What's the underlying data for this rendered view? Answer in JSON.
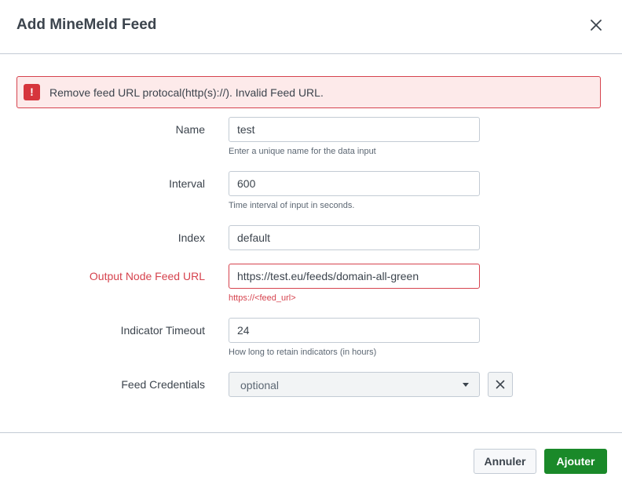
{
  "dialog": {
    "title": "Add MineMeld Feed"
  },
  "alert": {
    "icon": "!",
    "message": "Remove feed URL protocal(http(s)://). Invalid Feed URL."
  },
  "fields": {
    "name": {
      "label": "Name",
      "value": "test",
      "help": "Enter a unique name for the data input"
    },
    "interval": {
      "label": "Interval",
      "value": "600",
      "help": "Time interval of input in seconds."
    },
    "index": {
      "label": "Index",
      "value": "default"
    },
    "feed_url": {
      "label": "Output Node Feed URL",
      "value": "https://test.eu/feeds/domain-all-green",
      "help": "https://<feed_url>"
    },
    "timeout": {
      "label": "Indicator Timeout",
      "value": "24",
      "help": "How long to retain indicators (in hours)"
    },
    "credentials": {
      "label": "Feed Credentials",
      "value": "optional"
    }
  },
  "footer": {
    "cancel_label": "Annuler",
    "submit_label": "Ajouter"
  },
  "colors": {
    "error": "#d6434e",
    "primary": "#1a8929",
    "border": "#c3cbd4"
  }
}
